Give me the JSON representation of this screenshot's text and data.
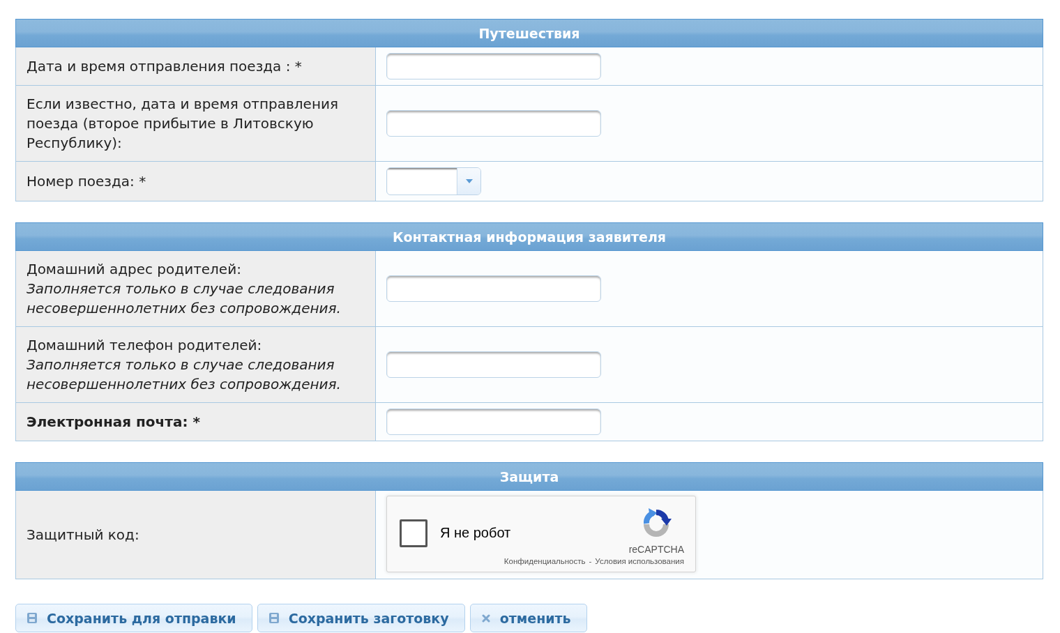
{
  "sections": [
    {
      "title": "Путешествия",
      "rows": [
        {
          "label": "Дата и время отправления поезда : *",
          "bold": false,
          "kind": "text"
        },
        {
          "label": "Если известно, дата и время отправления поезда (второе прибытие в Литовскую Республику):",
          "bold": false,
          "kind": "text"
        },
        {
          "label": "Номер поезда: *",
          "bold": false,
          "kind": "select"
        }
      ]
    },
    {
      "title": "Контактная информация заявителя",
      "rows": [
        {
          "label": "Домашний адрес родителей:",
          "note": "Заполняется только в случае следования несовершеннолетних без сопровождения.",
          "bold": false,
          "kind": "text"
        },
        {
          "label": "Домашний телефон родителей:",
          "note": "Заполняется только в случае следования несовершеннолетних без сопровождения.",
          "bold": false,
          "kind": "text"
        },
        {
          "label": "Электронная почта: *",
          "bold": true,
          "kind": "text"
        }
      ]
    },
    {
      "title": "Защита",
      "rows": [
        {
          "label": "Защитный код:",
          "bold": false,
          "kind": "captcha",
          "captcha": {
            "checked": false,
            "label": "Я не робот",
            "brand": "reCAPTCHA",
            "privacy_link": "Конфиденциальность",
            "separator": "-",
            "terms_link": "Условия использования"
          }
        }
      ]
    }
  ],
  "buttons": [
    {
      "label": "Сохранить для отправки",
      "kind": "save"
    },
    {
      "label": "Сохранить заготовку",
      "kind": "save"
    },
    {
      "label": "отменить",
      "kind": "cancel"
    }
  ]
}
